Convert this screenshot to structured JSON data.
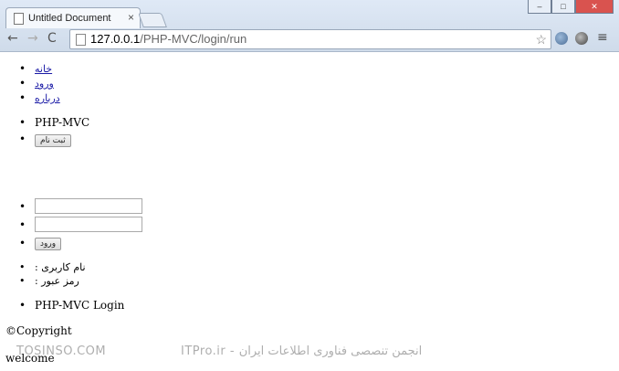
{
  "browser": {
    "tab_title": "Untitled Document",
    "tab_close": "×",
    "window_min": "–",
    "window_max": "□",
    "window_close": "✕",
    "url_host": "127.0.0.1",
    "url_path": "/PHP-MVC/login/run",
    "back": "←",
    "forward": "→",
    "reload": "C",
    "star": "☆",
    "menu": "≡"
  },
  "menu": {
    "items": [
      "خانه",
      "ورود",
      "درباره"
    ]
  },
  "brand": {
    "name": "PHP-MVC",
    "register_button": "ثبت نام"
  },
  "form": {
    "username_value": "",
    "password_value": "",
    "login_button": "ورود"
  },
  "labels": {
    "username": ": نام کاربری",
    "password": ": رمز عبور"
  },
  "login_title": "PHP-MVC Login",
  "footer": {
    "copyright": "©Copyright",
    "welcome": "welcome"
  },
  "watermark": {
    "left": "TOSINSO.COM",
    "right": "ITPro.ir - انجمن تنصصی فناوری اطلاعات ایران"
  }
}
